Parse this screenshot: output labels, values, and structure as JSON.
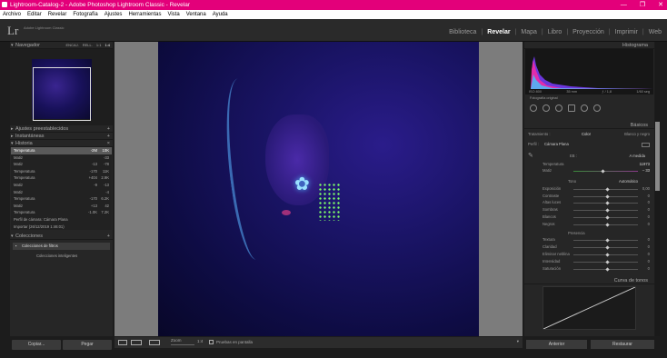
{
  "window": {
    "title": "Lightroom-Catalog-2 - Adobe Photoshop Lightroom Classic - Revelar",
    "buttons": [
      "—",
      "❐",
      "✕"
    ]
  },
  "menu": [
    "Archivo",
    "Editar",
    "Revelar",
    "Fotografía",
    "Ajustes",
    "Herramientas",
    "Vista",
    "Ventana",
    "Ayuda"
  ],
  "identity": {
    "logo": "Lr",
    "catalog": "Adobe Lightroom Classic"
  },
  "modules": [
    "Biblioteca",
    "Revelar",
    "Mapa",
    "Libro",
    "Proyección",
    "Imprimir",
    "Web"
  ],
  "active_module": "Revelar",
  "left": {
    "navigator": {
      "title": "Navegador",
      "zoom": [
        "ENCAJ.",
        "RELL.",
        "1:1",
        "1:4"
      ]
    },
    "presets": "Ajustes preestablecidos",
    "snapshots": "Instantáneas",
    "history": {
      "title": "Historia",
      "rows": [
        {
          "name": "Temperatura",
          "a": "-2M",
          "b": "10K",
          "sel": true
        },
        {
          "name": "Matiz",
          "a": "",
          "b": "-33"
        },
        {
          "name": "Matiz",
          "a": "-13",
          "b": "-78"
        },
        {
          "name": "Temperatura",
          "a": "-170",
          "b": "11K"
        },
        {
          "name": "Temperatura",
          "a": "+404",
          "b": "2.9K"
        },
        {
          "name": "Matiz",
          "a": "-9",
          "b": "-13"
        },
        {
          "name": "Matiz",
          "a": "",
          "b": "-4"
        },
        {
          "name": "Temperatura",
          "a": "-170",
          "b": "6.2K"
        },
        {
          "name": "Matiz",
          "a": "+13",
          "b": "42"
        },
        {
          "name": "Temperatura",
          "a": "-1.0K",
          "b": "7.2K"
        },
        {
          "name": "Perfil de cámara: Cámara Plana",
          "a": "",
          "b": ""
        },
        {
          "name": "Importar (26/12/2019 1:46:01)",
          "a": "",
          "b": ""
        }
      ]
    },
    "collections": {
      "title": "Colecciones",
      "rows": [
        "Colecciones de filtros",
        "Colecciones inteligentes"
      ]
    },
    "copy_label": "Copiar...",
    "paste_label": "Pegar"
  },
  "toolbar": {
    "zoom_label": "Zoom",
    "zoom_value": "1:4",
    "softproof": "Pruebas en pantalla"
  },
  "right": {
    "histogram": {
      "title": "Histograma",
      "iso": "ISO 800",
      "focal": "35 mm",
      "aperture": "ƒ / 1,8",
      "shutter": "1/60 seg",
      "original": "Fotografía original"
    },
    "basic": {
      "title": "Básicos",
      "treatment_label": "Tratamiento :",
      "color_label": "Color",
      "bw_label": "Blanco y negro",
      "profile_label": "Perfil :",
      "profile_value": "Cámara Plana",
      "wb_label": "EB :",
      "wb_value": "A medida",
      "temp_label": "Temperatura",
      "temp_value": "11973",
      "tint_label": "Matiz",
      "tint_value": "– 33",
      "tone_label": "Tono",
      "auto_label": "Automático",
      "sliders": [
        {
          "label": "Exposición",
          "value": "0,00"
        },
        {
          "label": "Contraste",
          "value": "0"
        },
        {
          "label": "Altas luces",
          "value": "0"
        },
        {
          "label": "Sombras",
          "value": "0"
        },
        {
          "label": "Blancos",
          "value": "0"
        },
        {
          "label": "Negros",
          "value": "0"
        }
      ],
      "presence_label": "Presencia",
      "presence": [
        {
          "label": "Textura",
          "value": "0"
        },
        {
          "label": "Claridad",
          "value": "0"
        },
        {
          "label": "Eliminar neblina",
          "value": "0"
        },
        {
          "label": "Intensidad",
          "value": "0"
        },
        {
          "label": "Saturación",
          "value": "0"
        }
      ]
    },
    "curve_title": "Curva de tonos",
    "prev_label": "Anterior",
    "reset_label": "Restaurar"
  }
}
